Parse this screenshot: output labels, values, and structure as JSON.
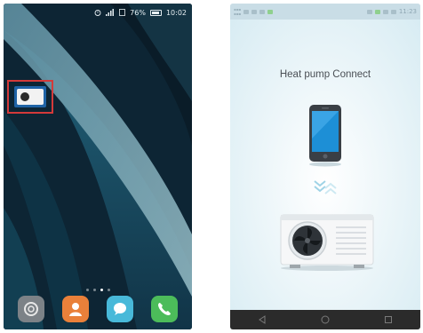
{
  "left_screen": {
    "status_bar": {
      "battery_percent": "76%",
      "time": "10:02"
    },
    "highlighted_app": {
      "icon": "heat-pump-app-icon",
      "highlight_color": "#d33a3a"
    },
    "page_indicator": {
      "pages": 4,
      "active_index": 2
    },
    "dock": [
      {
        "icon": "settings-icon",
        "color": "#7c8287"
      },
      {
        "icon": "contacts-icon",
        "color": "#e9803a"
      },
      {
        "icon": "messages-icon",
        "color": "#48b9d9"
      },
      {
        "icon": "phone-call-icon",
        "color": "#4cbc5a"
      }
    ]
  },
  "right_screen": {
    "status_bar": {
      "time": "11:23"
    },
    "title": "Heat pump Connect",
    "illustrations": [
      "smartphone-icon",
      "sync-arrows-icon",
      "heat-pump-unit-icon"
    ],
    "navbar": [
      "back-icon",
      "home-icon",
      "recents-icon"
    ]
  }
}
